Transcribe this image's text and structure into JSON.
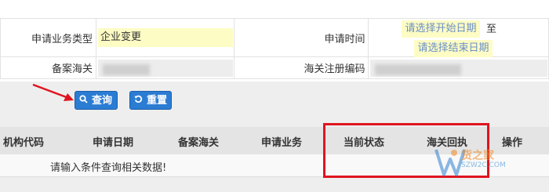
{
  "form": {
    "business_type_label": "申请业务类型",
    "business_type_value": "企业变更",
    "apply_time_label": "申请时间",
    "start_placeholder": "请选择开始日期",
    "to_label": "至",
    "end_placeholder": "请选择结束日期",
    "customs_label": "备案海关",
    "reg_code_label": "海关注册编码"
  },
  "buttons": {
    "query": "查询",
    "reset": "重置"
  },
  "table": {
    "headers": [
      "机构代码",
      "申请日期",
      "备案海关",
      "申请业务",
      "当前状态",
      "海关回执",
      "操作"
    ],
    "empty_text": "请输入条件查询相关数据!"
  },
  "watermark": {
    "text": "货之家",
    "subtext": "SZW2C.COM"
  },
  "colors": {
    "primary_button": "#2b7cd3",
    "highlight": "#fdfcc4",
    "annotation_red": "#e0141e"
  }
}
